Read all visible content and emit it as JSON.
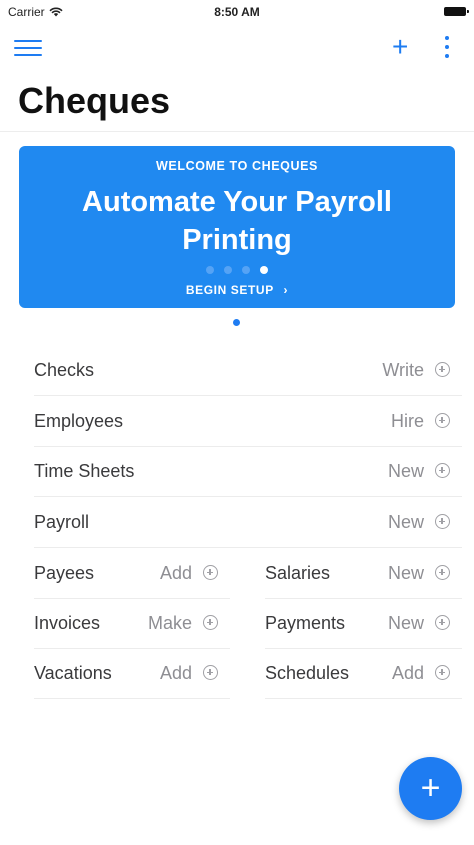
{
  "status": {
    "carrier": "Carrier",
    "time": "8:50 AM"
  },
  "header": {
    "title": "Cheques"
  },
  "banner": {
    "kicker": "WELCOME TO CHEQUES",
    "headline_line1": "Automate Your Payroll",
    "headline_line2": "Printing",
    "cta": "BEGIN SETUP",
    "cta_icon": "chevron-right-icon"
  },
  "rows": [
    {
      "label": "Checks",
      "action": "Write"
    },
    {
      "label": "Employees",
      "action": "Hire"
    },
    {
      "label": "Time Sheets",
      "action": "New"
    },
    {
      "label": "Payroll",
      "action": "New"
    }
  ],
  "grid": [
    {
      "label": "Payees",
      "action": "Add"
    },
    {
      "label": "Salaries",
      "action": "New"
    },
    {
      "label": "Invoices",
      "action": "Make"
    },
    {
      "label": "Payments",
      "action": "New"
    },
    {
      "label": "Vacations",
      "action": "Add"
    },
    {
      "label": "Schedules",
      "action": "Add"
    }
  ],
  "colors": {
    "accent": "#1e7cf2",
    "banner": "#2089f0"
  }
}
